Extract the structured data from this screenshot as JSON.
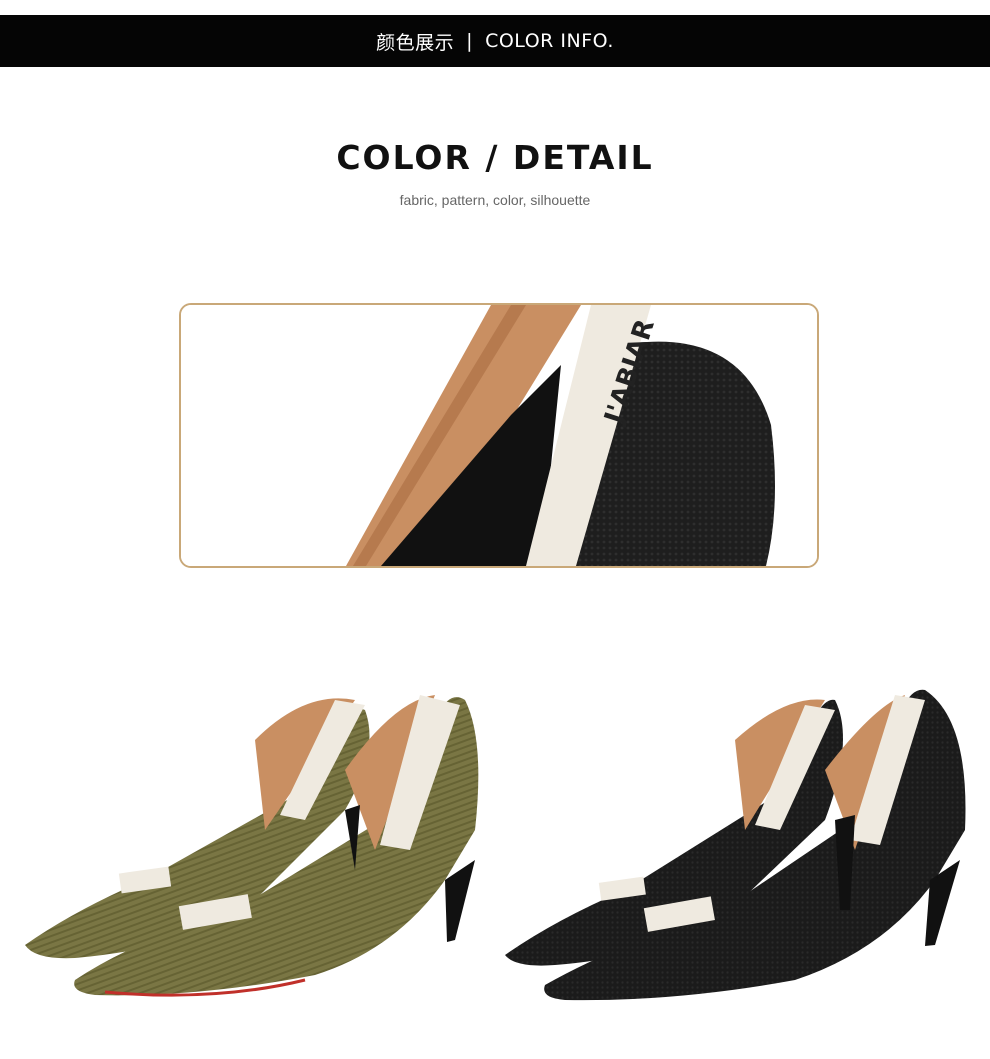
{
  "header": {
    "title_cn": "颜色展示",
    "separator": "|",
    "title_en": "COLOR INFO."
  },
  "section": {
    "title": "COLOR / DETAIL",
    "subtitle": "fabric, pattern, color, silhouette"
  },
  "products": {
    "brand_label": "J'ABIAR",
    "colors": [
      "olive-green",
      "black"
    ]
  },
  "colors": {
    "bar": "#050505",
    "frame_border": "#c9a878",
    "olive": "#7a7644",
    "black_knit": "#1b1b1b",
    "lining": "#c98f62"
  }
}
